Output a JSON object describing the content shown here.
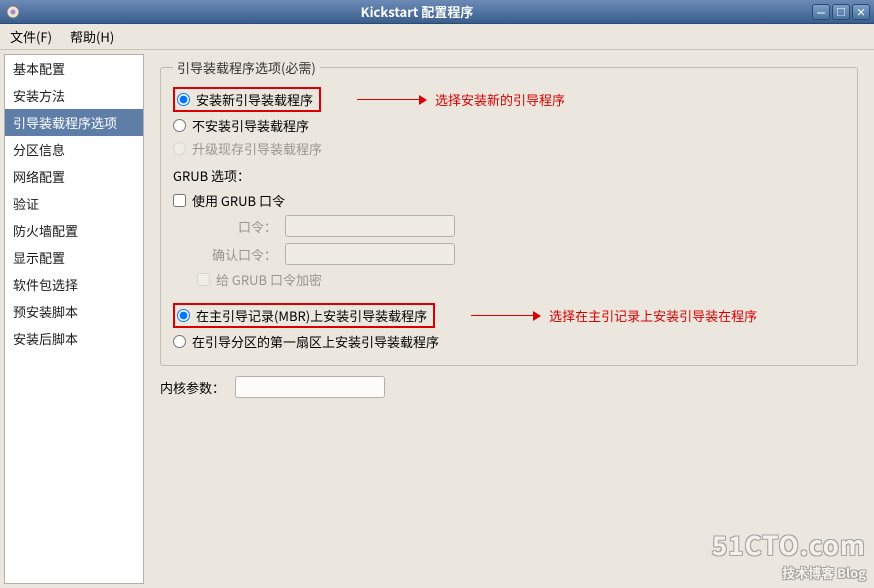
{
  "window": {
    "title": "Kickstart 配置程序",
    "buttons": {
      "min": "—",
      "max": "□",
      "close": "×"
    }
  },
  "menubar": {
    "file": "文件(F)",
    "help": "帮助(H)"
  },
  "sidebar": {
    "items": [
      {
        "label": "基本配置"
      },
      {
        "label": "安装方法"
      },
      {
        "label": "引导装载程序选项",
        "selected": true
      },
      {
        "label": "分区信息"
      },
      {
        "label": "网络配置"
      },
      {
        "label": "验证"
      },
      {
        "label": "防火墙配置"
      },
      {
        "label": "显示配置"
      },
      {
        "label": "软件包选择"
      },
      {
        "label": "预安装脚本"
      },
      {
        "label": "安装后脚本"
      }
    ]
  },
  "main": {
    "group_legend": "引导装载程序选项(必需)",
    "install_group": {
      "opt_install_new": "安装新引导装载程序",
      "opt_no_install": "不安装引导装载程序",
      "opt_upgrade": "升级现存引导装载程序"
    },
    "annot1": "选择安装新的引导程序",
    "grub": {
      "heading": "GRUB 选项：",
      "use_password": "使用 GRUB 口令",
      "password_label": "口令：",
      "confirm_label": "确认口令：",
      "encrypt": "给 GRUB 口令加密"
    },
    "loc_group": {
      "opt_mbr": "在主引导记录(MBR)上安装引导装载程序",
      "opt_first_sector": "在引导分区的第一扇区上安装引导装载程序"
    },
    "annot2": "选择在主引记录上安装引导装在程序",
    "kernel_label": "内核参数：",
    "kernel_value": ""
  },
  "watermark": {
    "big": "51CTO.com",
    "small": "技术博客  Blog"
  }
}
